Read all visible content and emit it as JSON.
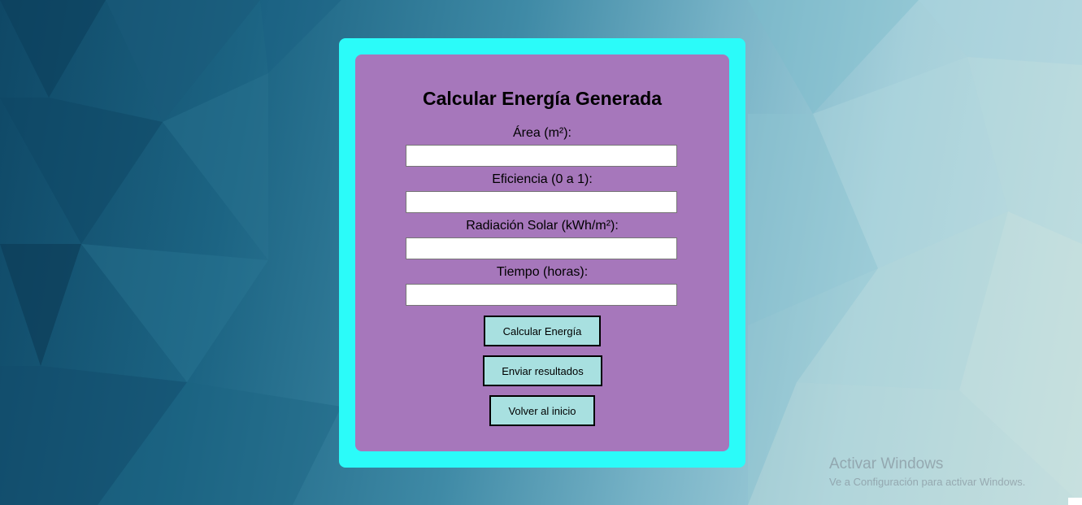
{
  "form": {
    "title": "Calcular Energía Generada",
    "fields": [
      {
        "label": "Área (m²):",
        "value": "",
        "placeholder": ""
      },
      {
        "label": "Eficiencia (0 a 1):",
        "value": "",
        "placeholder": ""
      },
      {
        "label": "Radiación Solar (kWh/m²):",
        "value": "",
        "placeholder": ""
      },
      {
        "label": "Tiempo (horas):",
        "value": "",
        "placeholder": ""
      }
    ],
    "buttons": {
      "calculate": "Calcular Energía",
      "send": "Enviar resultados",
      "back": "Volver al inicio"
    }
  },
  "watermark": {
    "title": "Activar Windows",
    "subtitle": "Ve a Configuración para activar Windows."
  },
  "colors": {
    "outer_card": "#2bfbf9",
    "inner_card": "#a677bb",
    "button_bg": "#a8e0e0"
  }
}
